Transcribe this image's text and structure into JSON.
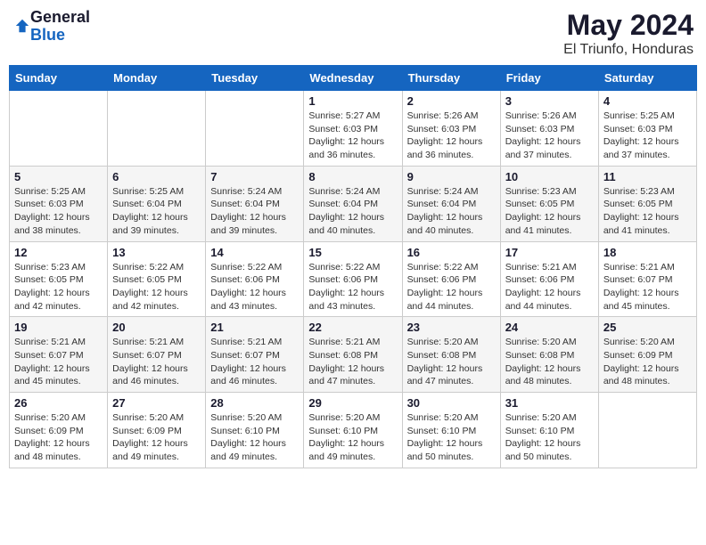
{
  "header": {
    "logo_general": "General",
    "logo_blue": "Blue",
    "month_year": "May 2024",
    "location": "El Triunfo, Honduras"
  },
  "calendar": {
    "weekdays": [
      "Sunday",
      "Monday",
      "Tuesday",
      "Wednesday",
      "Thursday",
      "Friday",
      "Saturday"
    ],
    "weeks": [
      [
        {
          "day": "",
          "info": ""
        },
        {
          "day": "",
          "info": ""
        },
        {
          "day": "",
          "info": ""
        },
        {
          "day": "1",
          "info": "Sunrise: 5:27 AM\nSunset: 6:03 PM\nDaylight: 12 hours\nand 36 minutes."
        },
        {
          "day": "2",
          "info": "Sunrise: 5:26 AM\nSunset: 6:03 PM\nDaylight: 12 hours\nand 36 minutes."
        },
        {
          "day": "3",
          "info": "Sunrise: 5:26 AM\nSunset: 6:03 PM\nDaylight: 12 hours\nand 37 minutes."
        },
        {
          "day": "4",
          "info": "Sunrise: 5:25 AM\nSunset: 6:03 PM\nDaylight: 12 hours\nand 37 minutes."
        }
      ],
      [
        {
          "day": "5",
          "info": "Sunrise: 5:25 AM\nSunset: 6:03 PM\nDaylight: 12 hours\nand 38 minutes."
        },
        {
          "day": "6",
          "info": "Sunrise: 5:25 AM\nSunset: 6:04 PM\nDaylight: 12 hours\nand 39 minutes."
        },
        {
          "day": "7",
          "info": "Sunrise: 5:24 AM\nSunset: 6:04 PM\nDaylight: 12 hours\nand 39 minutes."
        },
        {
          "day": "8",
          "info": "Sunrise: 5:24 AM\nSunset: 6:04 PM\nDaylight: 12 hours\nand 40 minutes."
        },
        {
          "day": "9",
          "info": "Sunrise: 5:24 AM\nSunset: 6:04 PM\nDaylight: 12 hours\nand 40 minutes."
        },
        {
          "day": "10",
          "info": "Sunrise: 5:23 AM\nSunset: 6:05 PM\nDaylight: 12 hours\nand 41 minutes."
        },
        {
          "day": "11",
          "info": "Sunrise: 5:23 AM\nSunset: 6:05 PM\nDaylight: 12 hours\nand 41 minutes."
        }
      ],
      [
        {
          "day": "12",
          "info": "Sunrise: 5:23 AM\nSunset: 6:05 PM\nDaylight: 12 hours\nand 42 minutes."
        },
        {
          "day": "13",
          "info": "Sunrise: 5:22 AM\nSunset: 6:05 PM\nDaylight: 12 hours\nand 42 minutes."
        },
        {
          "day": "14",
          "info": "Sunrise: 5:22 AM\nSunset: 6:06 PM\nDaylight: 12 hours\nand 43 minutes."
        },
        {
          "day": "15",
          "info": "Sunrise: 5:22 AM\nSunset: 6:06 PM\nDaylight: 12 hours\nand 43 minutes."
        },
        {
          "day": "16",
          "info": "Sunrise: 5:22 AM\nSunset: 6:06 PM\nDaylight: 12 hours\nand 44 minutes."
        },
        {
          "day": "17",
          "info": "Sunrise: 5:21 AM\nSunset: 6:06 PM\nDaylight: 12 hours\nand 44 minutes."
        },
        {
          "day": "18",
          "info": "Sunrise: 5:21 AM\nSunset: 6:07 PM\nDaylight: 12 hours\nand 45 minutes."
        }
      ],
      [
        {
          "day": "19",
          "info": "Sunrise: 5:21 AM\nSunset: 6:07 PM\nDaylight: 12 hours\nand 45 minutes."
        },
        {
          "day": "20",
          "info": "Sunrise: 5:21 AM\nSunset: 6:07 PM\nDaylight: 12 hours\nand 46 minutes."
        },
        {
          "day": "21",
          "info": "Sunrise: 5:21 AM\nSunset: 6:07 PM\nDaylight: 12 hours\nand 46 minutes."
        },
        {
          "day": "22",
          "info": "Sunrise: 5:21 AM\nSunset: 6:08 PM\nDaylight: 12 hours\nand 47 minutes."
        },
        {
          "day": "23",
          "info": "Sunrise: 5:20 AM\nSunset: 6:08 PM\nDaylight: 12 hours\nand 47 minutes."
        },
        {
          "day": "24",
          "info": "Sunrise: 5:20 AM\nSunset: 6:08 PM\nDaylight: 12 hours\nand 48 minutes."
        },
        {
          "day": "25",
          "info": "Sunrise: 5:20 AM\nSunset: 6:09 PM\nDaylight: 12 hours\nand 48 minutes."
        }
      ],
      [
        {
          "day": "26",
          "info": "Sunrise: 5:20 AM\nSunset: 6:09 PM\nDaylight: 12 hours\nand 48 minutes."
        },
        {
          "day": "27",
          "info": "Sunrise: 5:20 AM\nSunset: 6:09 PM\nDaylight: 12 hours\nand 49 minutes."
        },
        {
          "day": "28",
          "info": "Sunrise: 5:20 AM\nSunset: 6:10 PM\nDaylight: 12 hours\nand 49 minutes."
        },
        {
          "day": "29",
          "info": "Sunrise: 5:20 AM\nSunset: 6:10 PM\nDaylight: 12 hours\nand 49 minutes."
        },
        {
          "day": "30",
          "info": "Sunrise: 5:20 AM\nSunset: 6:10 PM\nDaylight: 12 hours\nand 50 minutes."
        },
        {
          "day": "31",
          "info": "Sunrise: 5:20 AM\nSunset: 6:10 PM\nDaylight: 12 hours\nand 50 minutes."
        },
        {
          "day": "",
          "info": ""
        }
      ]
    ]
  }
}
